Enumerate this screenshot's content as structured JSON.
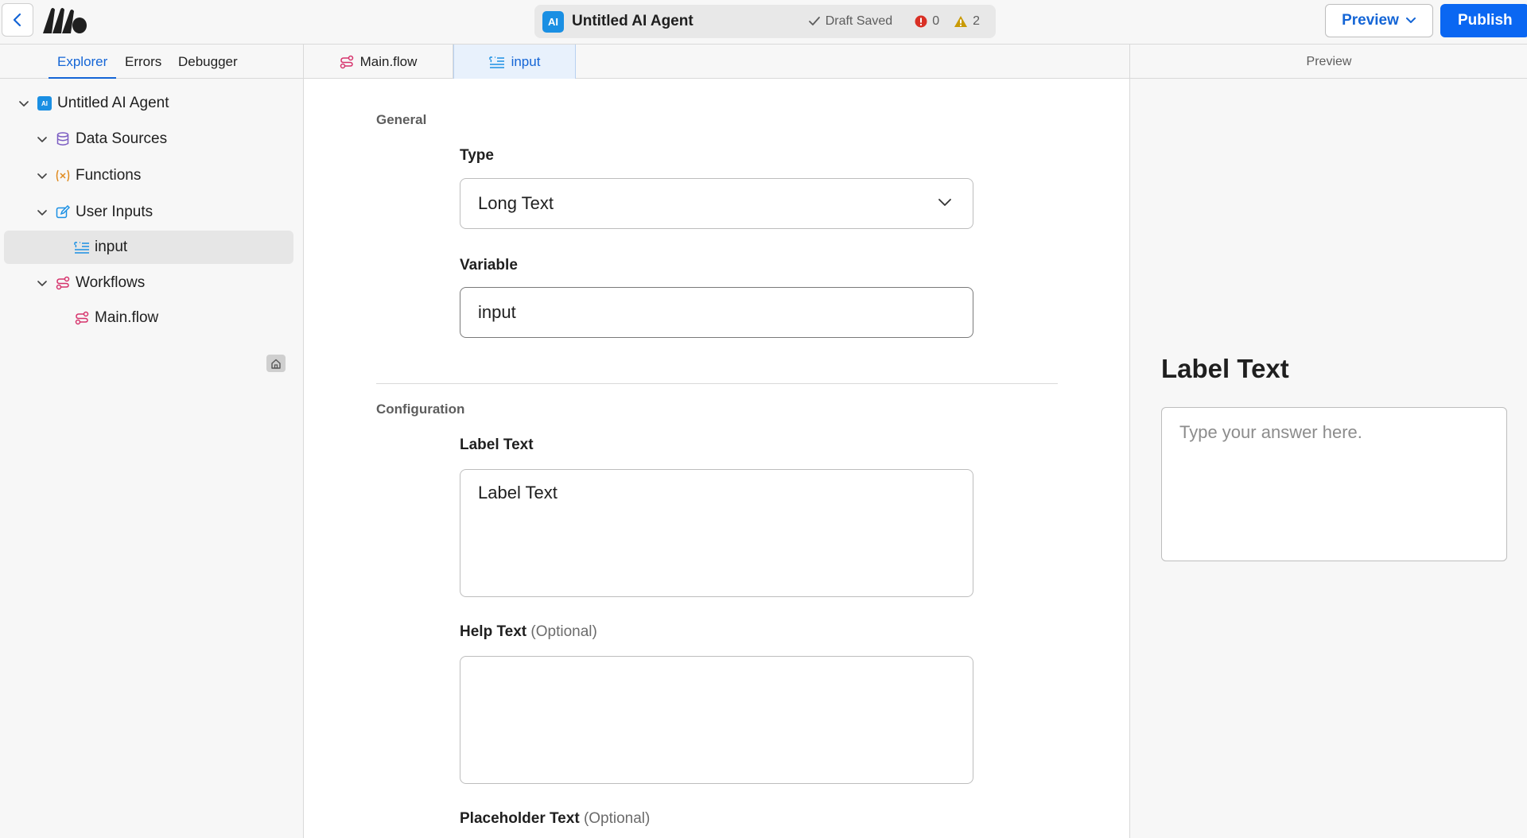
{
  "header": {
    "ai_badge": "AI",
    "title": "Untitled AI Agent",
    "draft_status": "Draft Saved",
    "error_count": "0",
    "warning_count": "2",
    "preview_label": "Preview",
    "publish_label": "Publish"
  },
  "sidebar": {
    "tabs": [
      "Explorer",
      "Errors",
      "Debugger"
    ],
    "active_tab": "Explorer",
    "tree": {
      "root": "Untitled AI Agent",
      "data_sources": "Data Sources",
      "functions": "Functions",
      "user_inputs": "User Inputs",
      "input": "input",
      "workflows": "Workflows",
      "main_flow": "Main.flow"
    },
    "icon_colors": {
      "ai": "#1a8fe3",
      "data_sources": "#7b5cc2",
      "functions": "#e08a1e",
      "user_inputs": "#1a8fe3",
      "workflows": "#d6336c"
    }
  },
  "editor": {
    "tabs": [
      "Main.flow",
      "input"
    ],
    "active_tab": "input"
  },
  "form": {
    "general_title": "General",
    "type_label": "Type",
    "type_value": "Long Text",
    "variable_label": "Variable",
    "variable_value": "input",
    "configuration_title": "Configuration",
    "label_text_label": "Label Text",
    "label_text_value": "Label Text",
    "help_text_label": "Help Text",
    "help_text_optional": "(Optional)",
    "help_text_value": "",
    "placeholder_label": "Placeholder Text",
    "placeholder_optional": "(Optional)"
  },
  "preview": {
    "header": "Preview",
    "label": "Label Text",
    "placeholder": "Type your answer here."
  },
  "colors": {
    "accent": "#1465d6",
    "publish_bg": "#0a67f2",
    "error": "#d93025",
    "warning": "#c99a06"
  }
}
